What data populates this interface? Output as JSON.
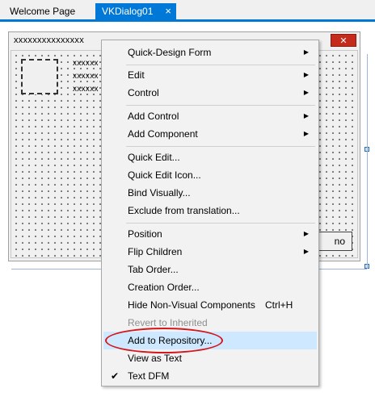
{
  "tabs": [
    {
      "label": "Welcome Page"
    },
    {
      "label": "VKDialog01",
      "close_icon": "×"
    }
  ],
  "form": {
    "caption": "xxxxxxxxxxxxxxx",
    "close_glyph": "✕",
    "text_lines": [
      "xxxxxx",
      "xxxxxx",
      "xxxxxx"
    ],
    "button_label": "no"
  },
  "menu": {
    "items": [
      {
        "label": "Quick-Design Form",
        "submenu": true
      },
      {
        "label": "Edit",
        "submenu": true
      },
      {
        "label": "Control",
        "submenu": true
      },
      {
        "label": "Add Control",
        "submenu": true
      },
      {
        "label": "Add Component",
        "submenu": true
      },
      {
        "label": "Quick Edit..."
      },
      {
        "label": "Quick Edit Icon..."
      },
      {
        "label": "Bind Visually..."
      },
      {
        "label": "Exclude from translation..."
      },
      {
        "label": "Position",
        "submenu": true
      },
      {
        "label": "Flip Children",
        "submenu": true
      },
      {
        "label": "Tab Order..."
      },
      {
        "label": "Creation Order..."
      },
      {
        "label": "Hide Non-Visual Components",
        "shortcut": "Ctrl+H"
      },
      {
        "label": "Revert to Inherited",
        "disabled": true
      },
      {
        "label": "Add to Repository...",
        "highlighted": true
      },
      {
        "label": "View as Text"
      },
      {
        "label": "Text DFM",
        "checked": true
      }
    ],
    "submenu_arrow": "▶",
    "check_glyph": "✔"
  },
  "colors": {
    "accent": "#0078d7",
    "highlight": "#cde8ff",
    "annotation": "#d4171c",
    "close_red": "#c42b1c"
  }
}
